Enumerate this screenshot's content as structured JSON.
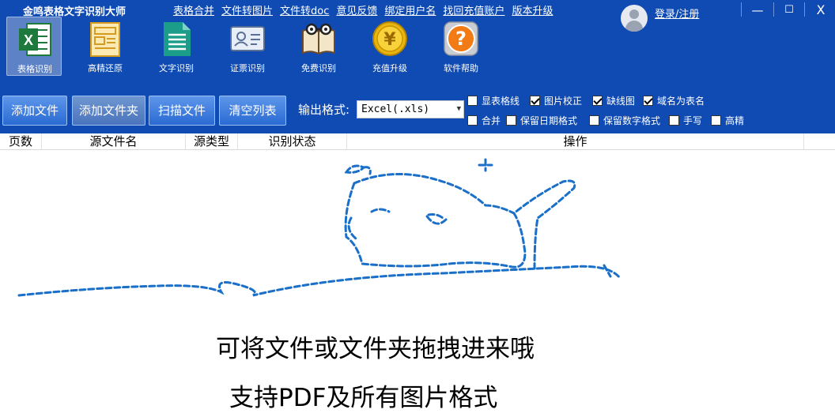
{
  "app": {
    "title": "金鸣表格文字识别大师"
  },
  "top_links": [
    "表格合并",
    "文件转图片",
    "文件转doc",
    "意见反馈",
    "绑定用户名",
    "找回充值账户",
    "版本升级"
  ],
  "user": {
    "login_label": "登录/注册"
  },
  "window_controls": {
    "minimize": "—",
    "maximize": "☐",
    "close": "X"
  },
  "ribbon": [
    {
      "label": "表格识别",
      "icon": "excel-icon",
      "active": true
    },
    {
      "label": "高精还原",
      "icon": "document-layout-icon",
      "active": false
    },
    {
      "label": "文字识别",
      "icon": "text-document-icon",
      "active": false
    },
    {
      "label": "证票识别",
      "icon": "id-card-icon",
      "active": false
    },
    {
      "label": "免费识别",
      "icon": "book-glasses-icon",
      "active": false
    },
    {
      "label": "充值升级",
      "icon": "yen-coin-icon",
      "active": false
    },
    {
      "label": "软件帮助",
      "icon": "help-icon",
      "active": false
    }
  ],
  "toolbar": {
    "add_file": "添加文件",
    "add_folder": "添加文件夹",
    "scan_file": "扫描文件",
    "clear_list": "清空列表",
    "output_label": "输出格式:",
    "output_value": "Excel(.xls)"
  },
  "options": [
    {
      "label": "显表格线",
      "checked": false
    },
    {
      "label": "图片校正",
      "checked": true
    },
    {
      "label": "缺线图",
      "checked": true
    },
    {
      "label": "域名为表名",
      "checked": true
    },
    {
      "label": "合并",
      "checked": false
    },
    {
      "label": "保留日期格式",
      "checked": false
    },
    {
      "label": "保留数字格式",
      "checked": false
    },
    {
      "label": "手写",
      "checked": false
    },
    {
      "label": "高精",
      "checked": false
    }
  ],
  "table_headers": [
    "页数",
    "源文件名",
    "源类型",
    "识别状态",
    "操作"
  ],
  "drop_hint": {
    "line1": "可将文件或文件夹拖拽进来哦",
    "line2": "支持PDF及所有图片格式"
  },
  "colors": {
    "primary_bar": "#0f4bb3",
    "button": "#2a6ad2",
    "sketch": "#1a6fc9"
  }
}
